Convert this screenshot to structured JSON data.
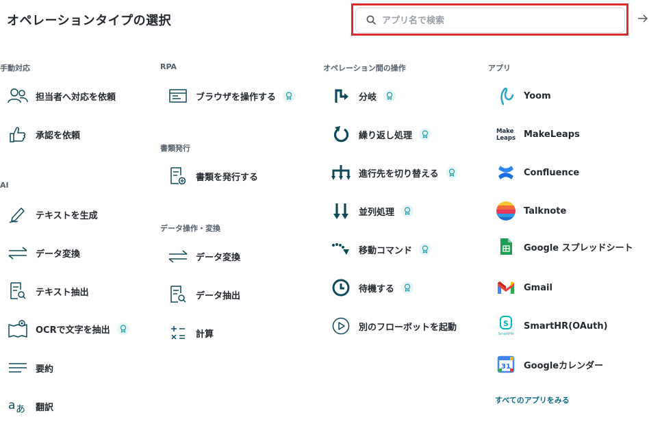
{
  "header": {
    "title": "オペレーションタイプの選択",
    "search_placeholder": "アプリ名で検索"
  },
  "columns": {
    "manual": {
      "heading": "手動対応",
      "items": [
        {
          "label": "担当者へ対応を依頼",
          "icon": "people-icon"
        },
        {
          "label": "承認を依頼",
          "icon": "thumbs-up-icon"
        }
      ]
    },
    "ai": {
      "heading": "AI",
      "items": [
        {
          "label": "テキストを生成",
          "icon": "pen-icon"
        },
        {
          "label": "データ変換",
          "icon": "swap-arrows-icon"
        },
        {
          "label": "テキスト抽出",
          "icon": "document-search-icon"
        },
        {
          "label": "OCRで文字を抽出",
          "icon": "ocr-icon",
          "badge": true
        },
        {
          "label": "要約",
          "icon": "summary-lines-icon"
        },
        {
          "label": "翻訳",
          "icon": "translate-icon"
        }
      ]
    },
    "rpa": {
      "heading": "RPA",
      "items": [
        {
          "label": "ブラウザを操作する",
          "icon": "browser-icon",
          "badge": true
        }
      ]
    },
    "document": {
      "heading": "書類発行",
      "items": [
        {
          "label": "書類を発行する",
          "icon": "document-add-icon"
        }
      ]
    },
    "data_ops": {
      "heading": "データ操作・変換",
      "items": [
        {
          "label": "データ変換",
          "icon": "swap-arrows-icon"
        },
        {
          "label": "データ抽出",
          "icon": "document-search-icon"
        },
        {
          "label": "計算",
          "icon": "calculator-icon"
        }
      ]
    },
    "operation": {
      "heading": "オペレーション間の操作",
      "items": [
        {
          "label": "分岐",
          "icon": "branch-icon",
          "badge": true
        },
        {
          "label": "繰り返し処理",
          "icon": "loop-icon",
          "badge": true
        },
        {
          "label": "進行先を切り替える",
          "icon": "switch-route-icon",
          "badge": true
        },
        {
          "label": "並列処理",
          "icon": "parallel-icon",
          "badge": true
        },
        {
          "label": "移動コマンド",
          "icon": "move-icon",
          "badge": true
        },
        {
          "label": "待機する",
          "icon": "clock-icon",
          "badge": true
        },
        {
          "label": "別のフローボットを起動",
          "icon": "play-circle-icon"
        }
      ]
    },
    "apps": {
      "heading": "アプリ",
      "items": [
        {
          "label": "Yoom",
          "icon": "yoom-logo-icon"
        },
        {
          "label": "MakeLeaps",
          "icon": "makeleaps-logo-icon",
          "logo_text_1": "Make",
          "logo_text_2": "Leaps"
        },
        {
          "label": "Confluence",
          "icon": "confluence-logo-icon"
        },
        {
          "label": "Talknote",
          "icon": "talknote-logo-icon"
        },
        {
          "label": "Google スプレッドシート",
          "icon": "google-sheets-logo-icon"
        },
        {
          "label": "Gmail",
          "icon": "gmail-logo-icon"
        },
        {
          "label": "SmartHR(OAuth)",
          "icon": "smarthr-logo-icon",
          "logo_text": "SmartHR"
        },
        {
          "label": "Googleカレンダー",
          "icon": "google-calendar-logo-icon",
          "logo_text": "31"
        }
      ],
      "see_all": "すべてのアプリをみる"
    }
  },
  "colors": {
    "accent": "#0b6b84",
    "icon_dark": "#0c4a5a",
    "highlight_border": "#e02b2b"
  }
}
